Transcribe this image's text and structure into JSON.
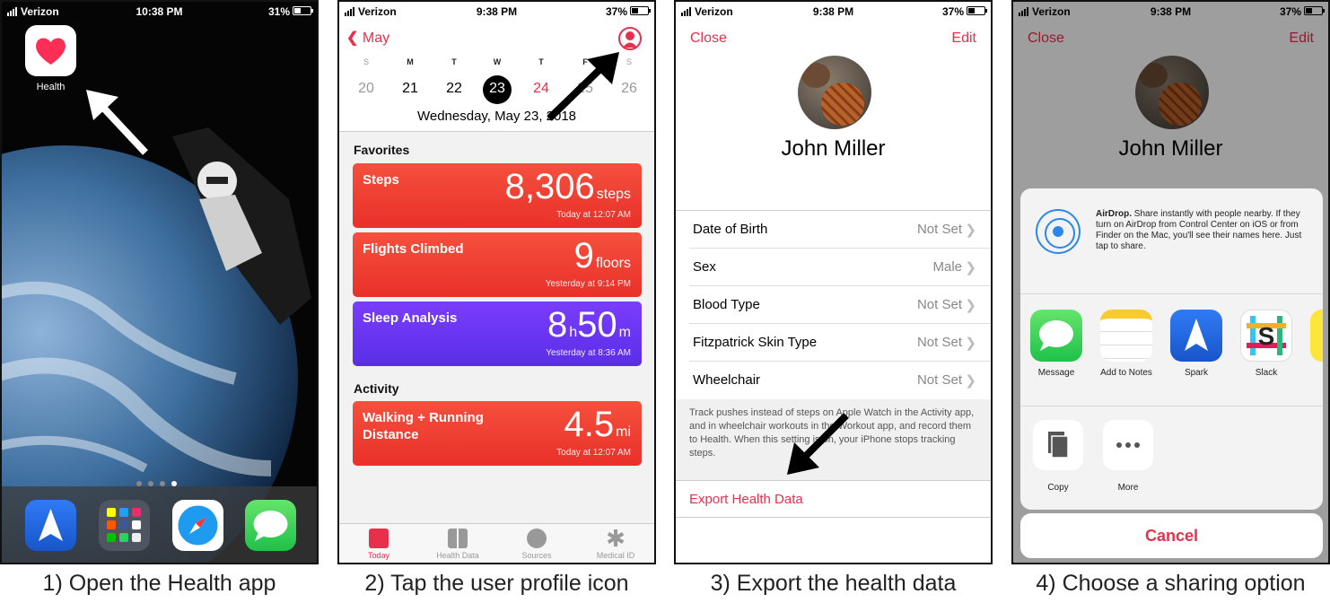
{
  "captions": [
    "1) Open the Health app",
    "2) Tap the user profile icon",
    "3) Export the health data",
    "4) Choose a sharing option"
  ],
  "screen1": {
    "status": {
      "carrier": "Verizon",
      "time": "10:38 PM",
      "battery": "31%"
    },
    "app_label": "Health"
  },
  "screen2": {
    "status": {
      "carrier": "Verizon",
      "time": "9:38 PM",
      "battery": "37%"
    },
    "back_label": "May",
    "day_names": [
      "S",
      "M",
      "T",
      "W",
      "T",
      "F",
      "S"
    ],
    "day_numbers": [
      "20",
      "21",
      "22",
      "23",
      "24",
      "25",
      "26"
    ],
    "full_date": "Wednesday, May 23, 2018",
    "favorites_heading": "Favorites",
    "activity_heading": "Activity",
    "cards": [
      {
        "title": "Steps",
        "value": "8,306",
        "unit": "steps",
        "time": "Today at 12:07 AM"
      },
      {
        "title": "Flights Climbed",
        "value": "9",
        "unit": "floors",
        "time": "Yesterday at 9:14 PM"
      },
      {
        "title": "Sleep Analysis",
        "hours": "8",
        "h_unit": "h",
        "minutes": "50",
        "m_unit": "m",
        "time": "Yesterday at 8:36 AM"
      },
      {
        "title": "Walking + Running Distance",
        "value": "4.5",
        "unit": "mi",
        "time": "Today at 12:07 AM"
      }
    ],
    "tabs": [
      "Today",
      "Health Data",
      "Sources",
      "Medical ID"
    ]
  },
  "screen3": {
    "status": {
      "carrier": "Verizon",
      "time": "9:38 PM",
      "battery": "37%"
    },
    "close_label": "Close",
    "edit_label": "Edit",
    "name": "John Miller",
    "rows": [
      {
        "label": "Date of Birth",
        "value": "Not Set"
      },
      {
        "label": "Sex",
        "value": "Male"
      },
      {
        "label": "Blood Type",
        "value": "Not Set"
      },
      {
        "label": "Fitzpatrick Skin Type",
        "value": "Not Set"
      },
      {
        "label": "Wheelchair",
        "value": "Not Set"
      }
    ],
    "note": "Track pushes instead of steps on Apple Watch in the Activity app, and in wheelchair workouts in the Workout app, and record them to Health. When this setting is on, your iPhone stops tracking steps.",
    "export_label": "Export Health Data"
  },
  "screen4": {
    "status": {
      "carrier": "Verizon",
      "time": "9:38 PM",
      "battery": "37%"
    },
    "close_label": "Close",
    "edit_label": "Edit",
    "name": "John Miller",
    "airdrop_bold": "AirDrop.",
    "airdrop_text": "Share instantly with people nearby. If they turn on AirDrop from Control Center on iOS or from Finder on the Mac, you'll see their names here. Just tap to share.",
    "apps": [
      "Message",
      "Add to Notes",
      "Spark",
      "Slack"
    ],
    "actions": [
      "Copy",
      "More"
    ],
    "cancel_label": "Cancel"
  },
  "colors": {
    "health_red": "#e8304c",
    "card_red": "#f1432f",
    "sleep_purple": "#6a35f0",
    "airdrop_blue": "#2b87f0"
  }
}
